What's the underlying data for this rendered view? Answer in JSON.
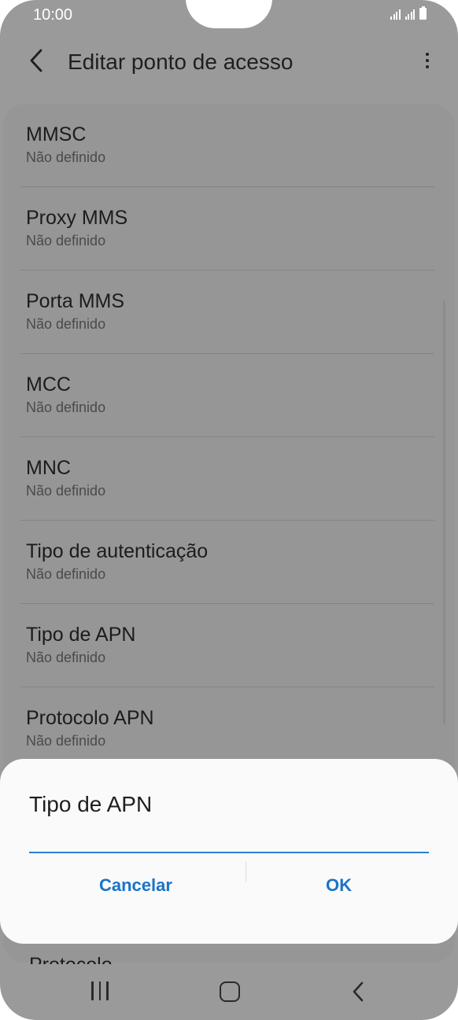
{
  "status_bar": {
    "time": "10:00"
  },
  "app_bar": {
    "title": "Editar ponto de acesso"
  },
  "list_items": [
    {
      "title": "MMSC",
      "subtitle": "Não definido"
    },
    {
      "title": "Proxy MMS",
      "subtitle": "Não definido"
    },
    {
      "title": "Porta MMS",
      "subtitle": "Não definido"
    },
    {
      "title": "MCC",
      "subtitle": "Não definido"
    },
    {
      "title": "MNC",
      "subtitle": "Não definido"
    },
    {
      "title": "Tipo de autenticação",
      "subtitle": "Não definido"
    },
    {
      "title": "Tipo de APN",
      "subtitle": "Não definido"
    },
    {
      "title": "Protocolo APN",
      "subtitle": "Não definido"
    }
  ],
  "peek_item": {
    "title": "Protocolo"
  },
  "dialog": {
    "title": "Tipo de APN",
    "input_value": "",
    "cancel_label": "Cancelar",
    "ok_label": "OK"
  },
  "colors": {
    "accent": "#1a73c8",
    "dim_background": "#9a9a9a"
  }
}
